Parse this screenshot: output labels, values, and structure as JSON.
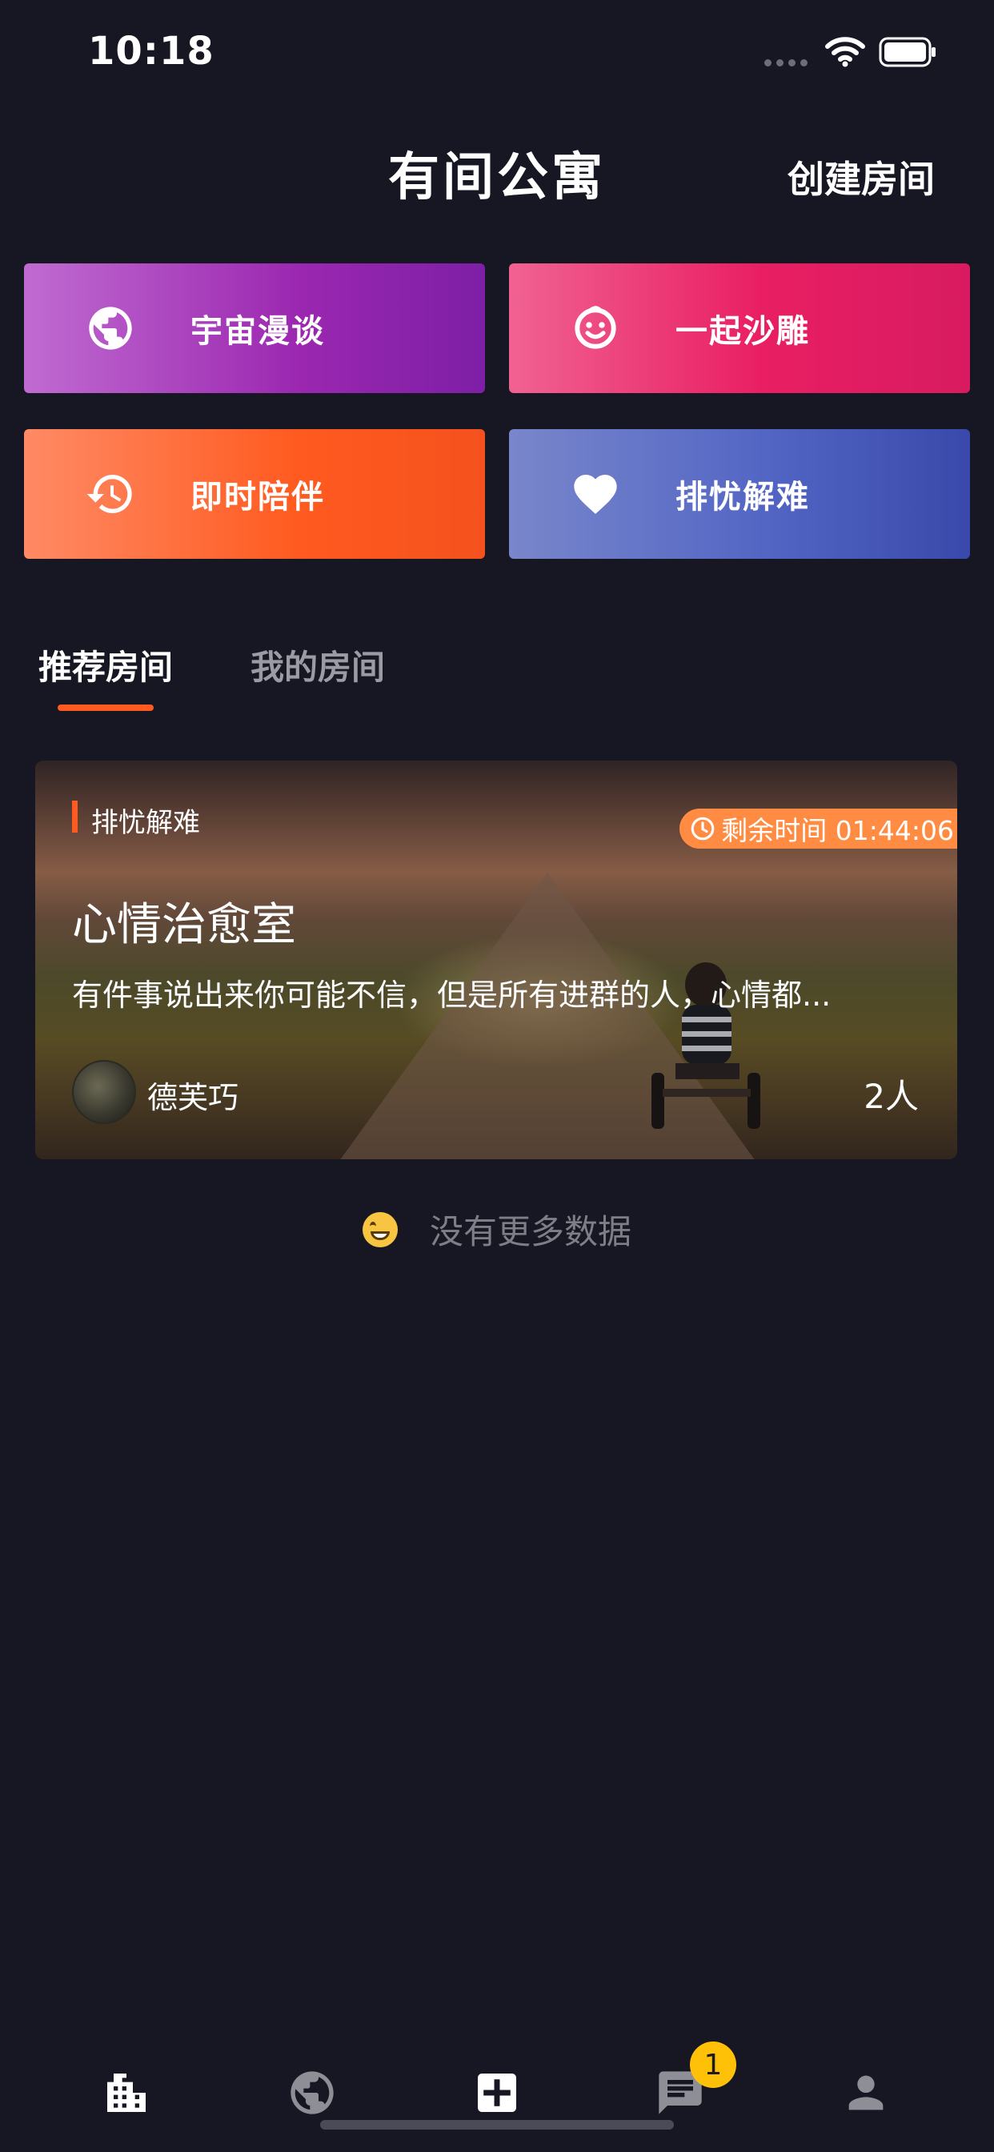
{
  "status_bar": {
    "time": "10:18"
  },
  "header": {
    "title": "有间公寓",
    "create_label": "创建房间"
  },
  "categories": [
    {
      "label": "宇宙漫谈",
      "icon": "globe-icon"
    },
    {
      "label": "一起沙雕",
      "icon": "smiley-face-icon"
    },
    {
      "label": "即时陪伴",
      "icon": "history-icon"
    },
    {
      "label": "排忧解难",
      "icon": "heart-icon"
    }
  ],
  "tabs": [
    {
      "label": "推荐房间",
      "active": true
    },
    {
      "label": "我的房间",
      "active": false
    }
  ],
  "rooms": [
    {
      "tag": "排忧解难",
      "timer_label": "剩余时间 01:44:06",
      "title": "心情治愈室",
      "description": "有件事说出来你可能不信，但是所有进群的人，心情都...",
      "owner": "德芙巧",
      "member_count": "2人"
    }
  ],
  "list_footer": {
    "text": "没有更多数据",
    "emoji": "grinning-face"
  },
  "tab_bar": {
    "items": [
      {
        "name": "apartment",
        "icon": "building-icon"
      },
      {
        "name": "explore",
        "icon": "globe-icon"
      },
      {
        "name": "create",
        "icon": "plus-square-icon"
      },
      {
        "name": "messages",
        "icon": "chat-icon",
        "badge": "1"
      },
      {
        "name": "profile",
        "icon": "person-icon"
      }
    ]
  },
  "colors": {
    "background": "#161722",
    "accent": "#ff5a1f",
    "badge": "#ffc107",
    "timer": "#ff8c42"
  }
}
